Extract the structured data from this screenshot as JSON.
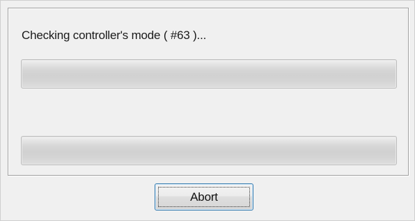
{
  "status_text": "Checking controller's mode ( #63 )...",
  "progress": {
    "primary_value": 0,
    "secondary_value": 0
  },
  "buttons": {
    "abort_label": "Abort"
  },
  "colors": {
    "window_bg": "#f0f0f0",
    "button_border_focus": "#3c7fb1"
  }
}
